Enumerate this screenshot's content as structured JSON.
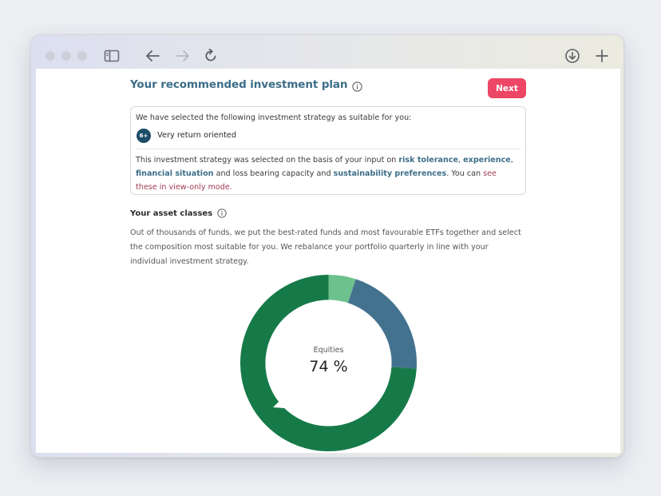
{
  "browser": {
    "icons": [
      "sidebar-icon",
      "back-arrow-icon",
      "forward-arrow-icon",
      "reload-icon",
      "download-icon",
      "new-tab-plus-icon"
    ]
  },
  "header": {
    "title": "Your recommended investment plan",
    "next_label": "Next"
  },
  "strategy": {
    "intro": "We have selected the following investment strategy as suitable for you:",
    "badge": "6+",
    "label": "Very return oriented",
    "text_1": "This investment strategy was selected on the basis of your input on ",
    "link_risk": "risk tolerance",
    "sep_1": ", ",
    "link_experience": "experience",
    "sep_2": ", ",
    "link_financial": "financial situation",
    "text_2": " and loss bearing capacity and ",
    "link_sustainability": "sustainability preferences",
    "text_3": ". You can ",
    "link_view": "see these in view-only mode."
  },
  "assets": {
    "title": "Your asset classes",
    "description": "Out of thousands of funds, we put the best-rated funds and most favourable ETFs together and select the composition most suitable for you. We rebalance your portfolio quarterly in line with your individual investment strategy.",
    "center_label": "Equities",
    "center_value": "74 %"
  },
  "colors": {
    "accent": "#ee4665",
    "title_blue": "#3c6e88",
    "equities": "#167a48",
    "bonds": "#43728f",
    "other": "#6cc18c"
  },
  "chart_data": {
    "type": "pie",
    "categories": [
      "",
      "",
      ""
    ],
    "values": [
      5,
      21,
      74
    ],
    "colors": [
      "#6cc18c",
      "#43728f",
      "#167a48"
    ],
    "highlighted": 2
  }
}
